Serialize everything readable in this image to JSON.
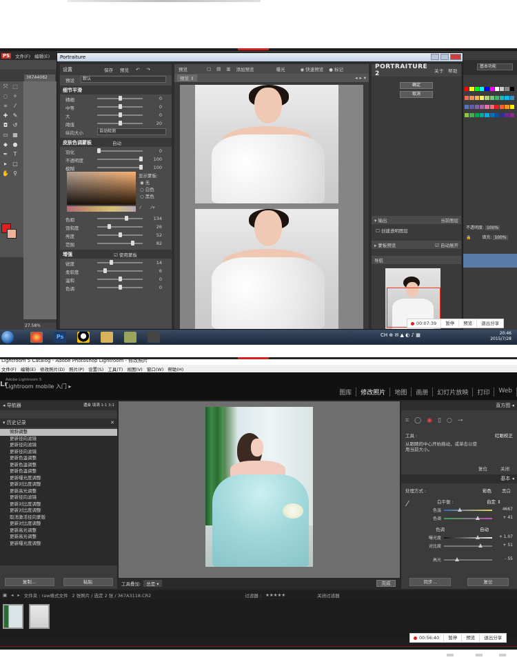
{
  "photoshop": {
    "menu": [
      "文件(F)",
      "编辑(E)"
    ],
    "doc_tab": "367A4082",
    "zoom": "27.58%",
    "workspace": "基本功能",
    "layers": {
      "opacity_label": "不透明度:",
      "opacity_value": "100%",
      "fill_label": "填充:",
      "fill_value": "100%"
    },
    "colors": {
      "foreground": "#e41e1e",
      "background": "#e9b49a"
    }
  },
  "portraiture": {
    "title": "Portraiture",
    "brand": "PORTRAITURE 2",
    "header": {
      "settings": "设置",
      "save": "保存",
      "preset_btn": "预览",
      "about": "关于",
      "help": "帮助"
    },
    "preset_label": "预设",
    "preset_value": "默认",
    "detail_section": "细节平滑",
    "detail_sliders": [
      {
        "label": "精细",
        "value": "0",
        "pos": 0.5
      },
      {
        "label": "中等",
        "value": "0",
        "pos": 0.5
      },
      {
        "label": "大",
        "value": "0",
        "pos": 0.5
      },
      {
        "label": "阈值",
        "value": "20",
        "pos": 0.5
      }
    ],
    "size_label": "纵向大小",
    "size_value": "自动检测",
    "skin_section": "皮肤色调蒙板",
    "skin_mode": "自动",
    "skin_sliders": [
      {
        "label": "羽化",
        "value": "0",
        "pos": 0.0
      },
      {
        "label": "不透明度",
        "value": "100",
        "pos": 1.0
      },
      {
        "label": "模糊",
        "value": "100",
        "pos": 1.0
      }
    ],
    "mask_options_label": "显示蒙板:",
    "mask_options": [
      "无",
      "白色",
      "黑色"
    ],
    "hue_sliders": [
      {
        "label": "色相",
        "value": "134",
        "pos": 0.65
      },
      {
        "label": "饱和度",
        "value": "26",
        "pos": 0.25
      },
      {
        "label": "亮度",
        "value": "52",
        "pos": 0.5
      },
      {
        "label": "范围",
        "value": "82",
        "pos": 0.8
      }
    ],
    "enhance_section": "增强",
    "enhance_use_mask": "使用蒙板",
    "enhance_sliders": [
      {
        "label": "锐度",
        "value": "14",
        "pos": 0.3
      },
      {
        "label": "柔软度",
        "value": "6",
        "pos": 0.15
      },
      {
        "label": "温和",
        "value": "0",
        "pos": 0.5
      },
      {
        "label": "色调",
        "value": "0",
        "pos": 0.5
      }
    ],
    "preview": {
      "title": "预览",
      "add_preset": "添加预览",
      "exposure": "曝光",
      "quick_preview": "快速预览",
      "mark": "标记",
      "tab_label": "预览"
    },
    "buttons": {
      "ok": "确定",
      "cancel": "取消"
    },
    "output_section": "输出",
    "output_target": "当前图层",
    "output_create": "创建透明图层",
    "mask_preview_section": "蒙板预览",
    "auto_open": "自动展开",
    "nav_section": "导航"
  },
  "taskbar": {
    "time": "20:46",
    "date": "2015/7/28"
  },
  "recording_top": {
    "time": "00:07:39",
    "pause": "暂停",
    "preview": "预览",
    "exit": "退出分享"
  },
  "lightroom": {
    "window_title": "Lightroom 5 Catalog - Adobe Photoshop Lightroom - 修改照片",
    "menu": [
      "文件(F)",
      "编辑(E)",
      "修改照片(D)",
      "照片(P)",
      "设置(S)",
      "工具(T)",
      "视图(V)",
      "窗口(W)",
      "帮助(H)"
    ],
    "brand_small": "Adobe Lightroom 5",
    "brand": "Lightroom mobile 入门",
    "modules": [
      "图库",
      "修改照片",
      "地图",
      "画册",
      "幻灯片放映",
      "打印",
      "Web"
    ],
    "navigator": {
      "title": "导航器",
      "fit": "适合",
      "fill": "填满",
      "one": "1:1",
      "three": "3:1"
    },
    "history_title": "历史记录",
    "history": [
      "倾斜调整",
      "更新径向滤镜",
      "更新径向滤镜",
      "更新径向滤镜",
      "更新色温调整",
      "更新色温调整",
      "更新色温调整",
      "更新曝光度调整",
      "更新对比度调整",
      "更新高光调整",
      "更新径向滤镜",
      "更新对比度调整",
      "更新对比度调整",
      "取消激活径向蒙版",
      "更新对比度调整",
      "更新高光调整",
      "更新高光调整",
      "更新曝光度调整"
    ],
    "copy_btn": "复制...",
    "paste_btn": "粘贴",
    "toolbar_label": "工具叠加:",
    "toolbar_value": "总是",
    "done_btn": "完成",
    "right": {
      "histogram": "直方图",
      "tool_label": "工具 :",
      "tool_value": "红眼校正",
      "tool_hint": "从眼睛的中心开始拖动，或单击以使用当前大小。",
      "reset": "复位",
      "close": "关闭",
      "basic": "基本",
      "treatment": "处理方式 :",
      "color": "彩色",
      "bw": "黑白",
      "wb_label": "白平衡 :",
      "wb_value": "自定",
      "temp_label": "色温",
      "temp_value": "4667",
      "tint_label": "色调",
      "tint_value": "+ 41",
      "tone_label": "色调",
      "auto": "自动",
      "exposure_label": "曝光度",
      "exposure_value": "+ 1.07",
      "contrast_label": "对比度",
      "contrast_value": "+ 51",
      "highlights_label": "高光",
      "highlights_value": "- 55",
      "sync": "同步...",
      "reset_btn": "复位"
    },
    "filmbar": {
      "folder": "文件夹 : raw格式文件",
      "count": "2 张照片 / 选定 2 张 / 367A3118.CR2",
      "filter": "过滤器 :",
      "filter_off": "关闭过滤器"
    }
  },
  "recording_bottom": {
    "time": "00:56:40",
    "pause": "暂停",
    "preview": "预览",
    "exit": "退出分享"
  }
}
